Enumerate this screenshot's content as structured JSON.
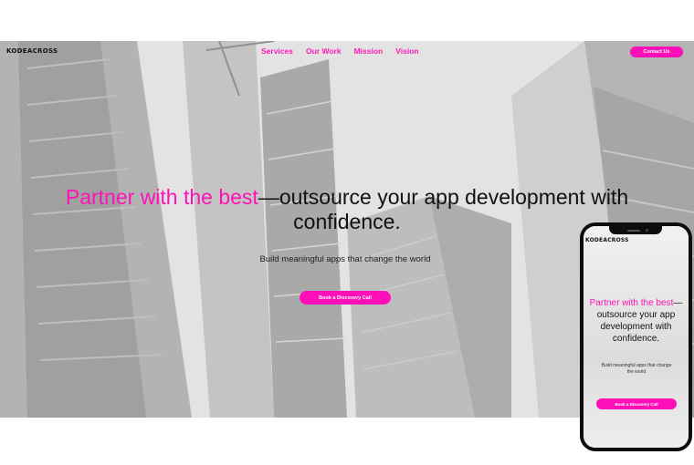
{
  "nav": {
    "logo": "KODEACROSS",
    "links": [
      {
        "label": "Services"
      },
      {
        "label": "Our Work"
      },
      {
        "label": "Mission"
      },
      {
        "label": "Vision"
      }
    ],
    "contact_label": "Contact Us"
  },
  "hero": {
    "headline_highlight": "Partner with the best",
    "headline_rest": "—outsource your app development with confidence.",
    "tagline": "Build meaningful apps that change the world",
    "cta_label": "Book a Discovery Call"
  },
  "mobile": {
    "logo": "KODEACROSS",
    "headline_highlight": "Partner with the best",
    "headline_rest": "—outsource your app development with confidence.",
    "tagline": "Build meaningful apps that change the world",
    "cta_label": "Book a Discovery Call"
  },
  "colors": {
    "accent": "#ff12b8",
    "button": "#ff0fb8"
  },
  "icons": {
    "background": "skyscrapers-background-image"
  }
}
